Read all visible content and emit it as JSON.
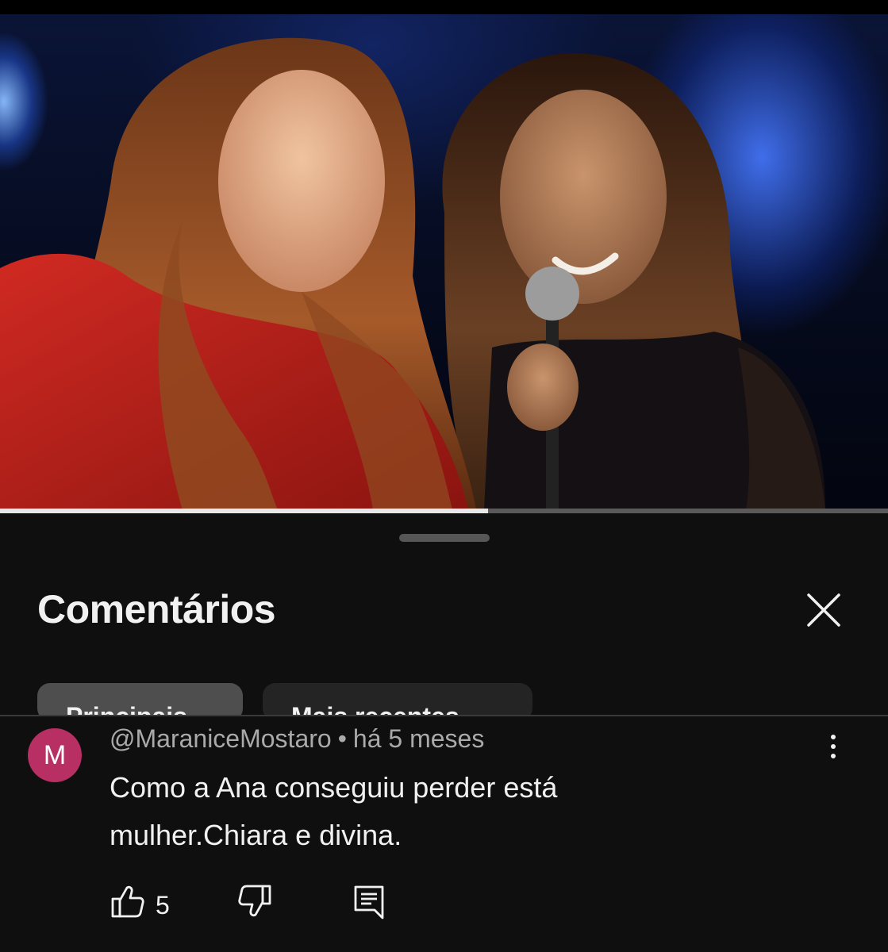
{
  "video": {
    "progress": 0.55,
    "scene": "video-frame-two-singers-on-stage"
  },
  "sheet": {
    "title": "Comentários",
    "close_icon": "close-icon"
  },
  "filters": [
    {
      "label": "Principais",
      "active": true
    },
    {
      "label": "Mais recentes",
      "active": false
    }
  ],
  "comment": {
    "avatar_letter": "M",
    "avatar_color": "#b72f63",
    "author": "@MaraniceMostaro",
    "separator": "•",
    "time": "há 5 meses",
    "text": "Como a Ana conseguiu perder está mulher.Chiara e divina.",
    "likes": "5",
    "icons": {
      "like": "thumbs-up-icon",
      "dislike": "thumbs-down-icon",
      "reply": "reply-comment-icon",
      "more": "more-vertical-icon"
    }
  }
}
